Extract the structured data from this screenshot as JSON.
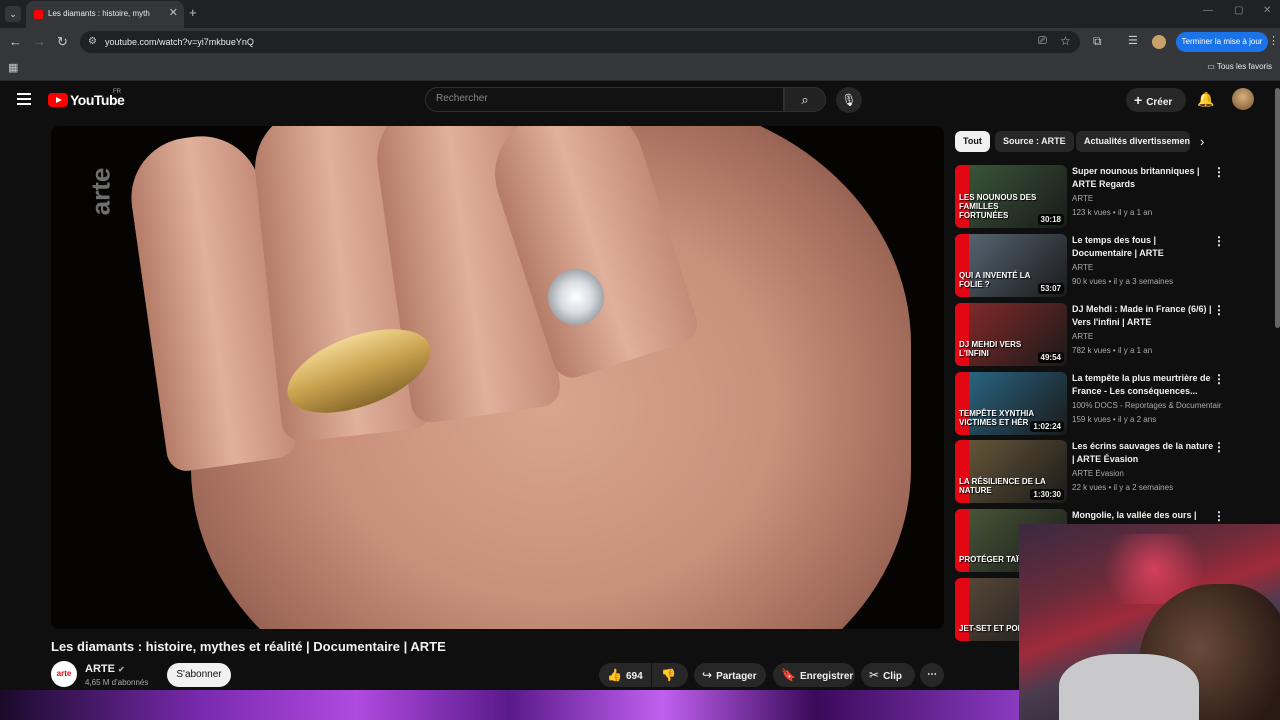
{
  "browser": {
    "tab_title": "Les diamants : histoire, myth",
    "url": "youtube.com/watch?v=yi7mkbueYnQ",
    "update_button": "Terminer la mise à jour",
    "bookmarks_all": "Tous les favoris"
  },
  "header": {
    "logo_text": "YouTube",
    "logo_region": "FR",
    "search_placeholder": "Rechercher",
    "create_label": "Créer"
  },
  "video": {
    "title": "Les diamants : histoire, mythes et réalité | Documentaire | ARTE",
    "watermark": "arte",
    "channel_name": "ARTE",
    "channel_avatar_text": "arte",
    "subscribers": "4,65 M d'abonnés",
    "subscribe_label": "S'abonner",
    "likes": "694",
    "share_label": "Partager",
    "save_label": "Enregistrer",
    "clip_label": "Clip"
  },
  "chips": [
    {
      "label": "Tout",
      "active": true
    },
    {
      "label": "Source : ARTE",
      "active": false
    },
    {
      "label": "Actualités divertissement",
      "active": false
    }
  ],
  "recommendations": [
    {
      "title": "Super nounous britanniques | ARTE Regards",
      "channel": "ARTE",
      "views": "123 k vues",
      "age": "il y a 1 an",
      "duration": "30:18",
      "overlay": "LES NOUNOUS DES FAMILLES FORTUNÉES",
      "color": "#3b5a3a"
    },
    {
      "title": "Le temps des fous | Documentaire | ARTE",
      "channel": "ARTE",
      "views": "90 k vues",
      "age": "il y a 3 semaines",
      "duration": "53:07",
      "overlay": "QUI A INVENTÉ LA FOLIE ?",
      "color": "#5a6a78"
    },
    {
      "title": "DJ Mehdi : Made in France (6/6) | Vers l'infini | ARTE",
      "channel": "ARTE",
      "views": "782 k vues",
      "age": "il y a 1 an",
      "duration": "49:54",
      "overlay": "DJ MEHDI VERS L'INFINI",
      "color": "#8a2a2a"
    },
    {
      "title": "La tempête la plus meurtrière de France - Les conséquences...",
      "channel": "100% DOCS - Reportages & Documentair...",
      "views": "159 k vues",
      "age": "il y a 2 ans",
      "duration": "1:02:24",
      "overlay": "TEMPÊTE XYNTHIA VICTIMES ET HÉR",
      "color": "#2a6a8a"
    },
    {
      "title": "Les écrins sauvages de la nature | ARTE Évasion",
      "channel": "ARTE Évasion",
      "views": "22 k vues",
      "age": "il y a 2 semaines",
      "duration": "1:30:30",
      "overlay": "LA RÉSILIENCE DE LA NATURE",
      "color": "#6a5a3a"
    },
    {
      "title": "Mongolie, la vallée des ours |",
      "channel": "",
      "views": "",
      "age": "",
      "duration": "",
      "overlay": "PROTÉGER TAÏGA RO",
      "color": "#4a5a3a"
    },
    {
      "title": "",
      "channel": "",
      "views": "",
      "age": "",
      "duration": "",
      "overlay": "JET-SET ET PORNO",
      "color": "#5a4a3a"
    }
  ]
}
